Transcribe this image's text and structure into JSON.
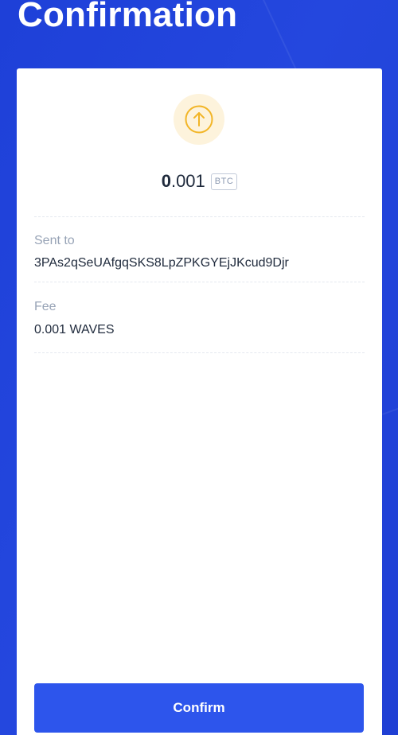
{
  "page": {
    "title": "Confirmation"
  },
  "transaction": {
    "direction_icon": "arrow-up-icon",
    "amount_int": "0",
    "amount_frac": ".001",
    "ticker": "BTC"
  },
  "details": {
    "sent_to_label": "Sent to",
    "sent_to_value": "3PAs2qSeUAfgqSKS8LpZPKGYEjJKcud9Djr",
    "fee_label": "Fee",
    "fee_value": "0.001 WAVES"
  },
  "actions": {
    "confirm_label": "Confirm"
  },
  "colors": {
    "background": "#2447de",
    "primary_button": "#2d55ec",
    "icon_accent": "#f2b526",
    "icon_bg": "#fdf3dc"
  }
}
